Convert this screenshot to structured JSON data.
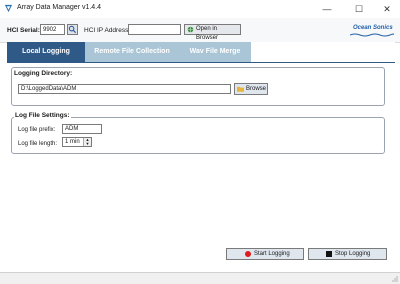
{
  "window": {
    "title": "Array Data Manager v1.4.4",
    "icon": "app-logo-icon",
    "controls": {
      "minimize": "—",
      "maximize": "☐",
      "close": "✕"
    }
  },
  "toolbar": {
    "serial_label": "HCI Serial:",
    "serial_value": "9902",
    "serial_search_icon": "search-icon",
    "ip_label": "HCI IP Address:",
    "ip_value": "",
    "open_browser_label": "Open in Browser",
    "logo_words": [
      "Ocean",
      "Sonics"
    ]
  },
  "tabs": [
    {
      "label": "Local Logging",
      "active": true
    },
    {
      "label": "Remote File Collection",
      "active": false
    },
    {
      "label": "Wav File Merge",
      "active": false
    }
  ],
  "logging_directory": {
    "title": "Logging Directory:",
    "path": "D:\\LoggedData\\ADM",
    "browse_label": "Browse"
  },
  "log_file_settings": {
    "title": "Log File Settings:",
    "prefix_label": "Log file prefix:",
    "prefix_value": "ADM",
    "length_label": "Log file length:",
    "length_value": "1 min"
  },
  "actions": {
    "start_label": "Start Logging",
    "stop_label": "Stop Logging"
  },
  "colors": {
    "accent": "#2f5a88",
    "tab_inactive": "#a9c5d6",
    "start_dot": "#e01b1b"
  }
}
